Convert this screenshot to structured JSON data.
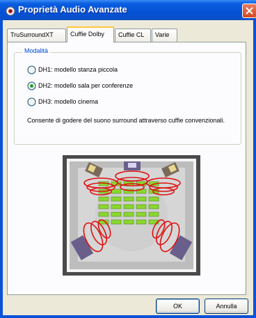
{
  "window": {
    "title": "Proprietà Audio Avanzate"
  },
  "tabs": [
    {
      "label": "TruSurroundXT"
    },
    {
      "label": "Cuffie Dolby",
      "active": true
    },
    {
      "label": "Cuffie CL"
    },
    {
      "label": "Varie"
    }
  ],
  "group": {
    "label": "Modalità",
    "options": [
      {
        "label": "DH1: modello stanza piccola",
        "selected": false
      },
      {
        "label": "DH2: modello sala per conferenze",
        "selected": true
      },
      {
        "label": "DH3: modello cinema",
        "selected": false
      }
    ],
    "description": "Consente di godere del suono surround attraverso cuffie convenzionali."
  },
  "buttons": {
    "ok": "OK",
    "cancel": "Annulla"
  },
  "colors": {
    "titlebar": "#0a52d8",
    "face": "#ece9d8",
    "accent_tab": "#ffc73c",
    "sound_waves": "#e01010",
    "seats": "#8bd630"
  }
}
